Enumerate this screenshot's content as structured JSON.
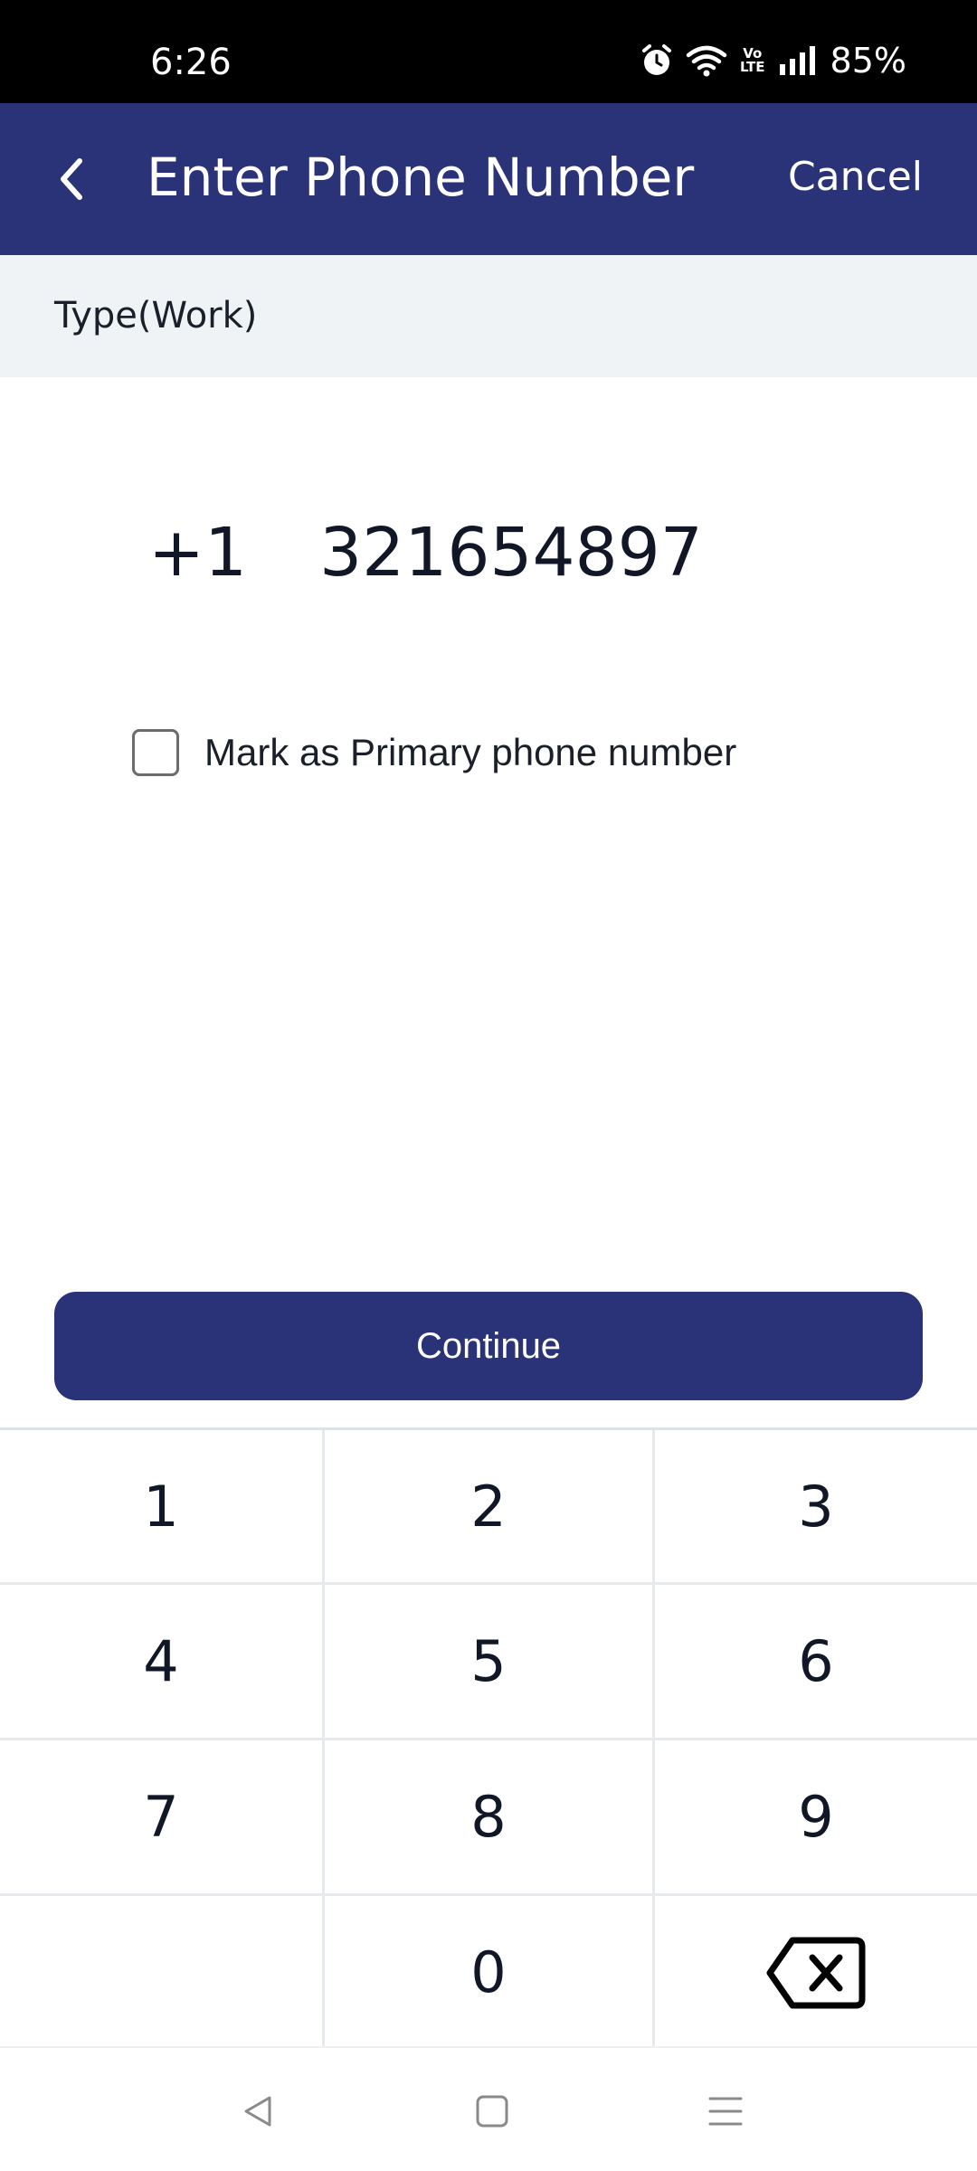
{
  "status_bar": {
    "time": "6:26",
    "battery": "85%",
    "network_label": "Vo\nLTE",
    "icons": [
      "alarm-icon",
      "wifi-icon",
      "volte-icon",
      "signal-icon"
    ]
  },
  "header": {
    "title": "Enter Phone Number",
    "cancel_label": "Cancel",
    "back_icon": "chevron-left-icon",
    "background": "#2b3378"
  },
  "type_banner": {
    "label": "Type(Work)"
  },
  "phone": {
    "country_code": "+1",
    "number": "321654897"
  },
  "primary_checkbox": {
    "label": "Mark as Primary phone number",
    "checked": false
  },
  "continue_label": "Continue",
  "keypad": {
    "keys": [
      "1",
      "2",
      "3",
      "4",
      "5",
      "6",
      "7",
      "8",
      "9",
      "",
      "0"
    ],
    "backspace_icon": "backspace-icon"
  },
  "nav": {
    "icons": [
      "back-triangle-icon",
      "home-square-icon",
      "recents-menu-icon"
    ]
  }
}
